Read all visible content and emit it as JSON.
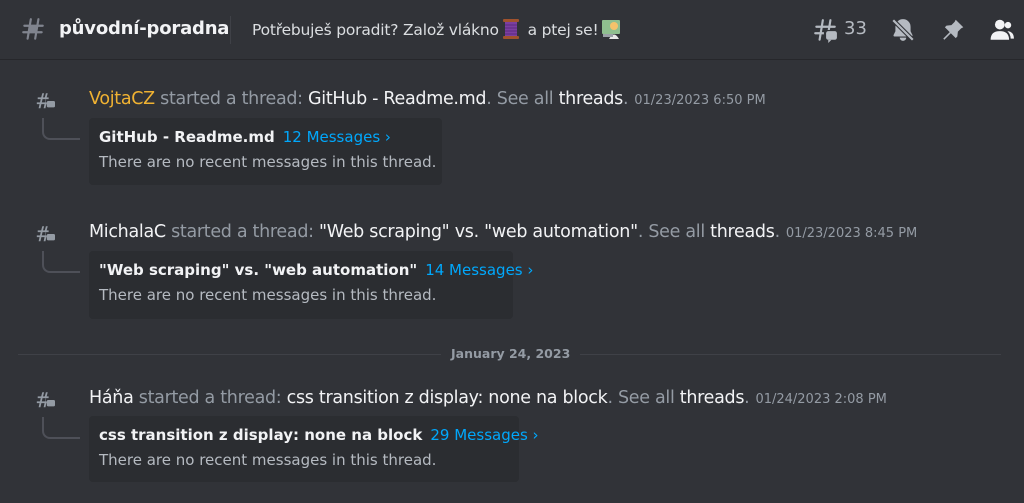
{
  "header": {
    "channel_name": "původní-poradna",
    "topic_part1": "Potřebuješ poradit? Založ vlákno",
    "topic_part2": " a ptej se!",
    "topic_emoji1": "thread-spool-emoji",
    "topic_emoji2": "person-at-computer-emoji",
    "threads_count": "33",
    "icons": [
      "threads-icon",
      "notifications-muted-icon",
      "pinned-messages-icon",
      "member-list-icon"
    ]
  },
  "messages": [
    {
      "author": "VojtaCZ",
      "author_color": "#f0b232",
      "started": " started a thread: ",
      "thread_title": "GitHub - Readme.md",
      "see_all": ". See all ",
      "threads_link": "threads",
      "period": ".",
      "timestamp": "01/23/2023 6:50 PM",
      "card_title": "GitHub - Readme.md",
      "card_link": "12 Messages ›",
      "card_body": "There are no recent messages in this thread."
    },
    {
      "author": "MichalaC",
      "author_color": "#f2f3f5",
      "started": " started a thread: ",
      "thread_title": "\"Web scraping\" vs. \"web automation\"",
      "see_all": ". See all ",
      "threads_link": "threads",
      "period": ".",
      "timestamp": "01/23/2023 8:45 PM",
      "card_title": "\"Web scraping\" vs. \"web automation\"",
      "card_link": "14 Messages ›",
      "card_body": "There are no recent messages in this thread."
    },
    {
      "author": "Háňa",
      "author_color": "#f2f3f5",
      "started": " started a thread: ",
      "thread_title": "css transition z display: none na block",
      "see_all": ". See all ",
      "threads_link": "threads",
      "period": ".",
      "timestamp": "01/24/2023 2:08 PM",
      "card_title": "css transition z display: none na block",
      "card_link": "29 Messages ›",
      "card_body": "There are no recent messages in this thread."
    }
  ],
  "date_divider": "January 24, 2023",
  "colors": {
    "background": "#313338",
    "card": "#2b2d31",
    "link": "#00a8fc",
    "muted": "#949ba4"
  }
}
